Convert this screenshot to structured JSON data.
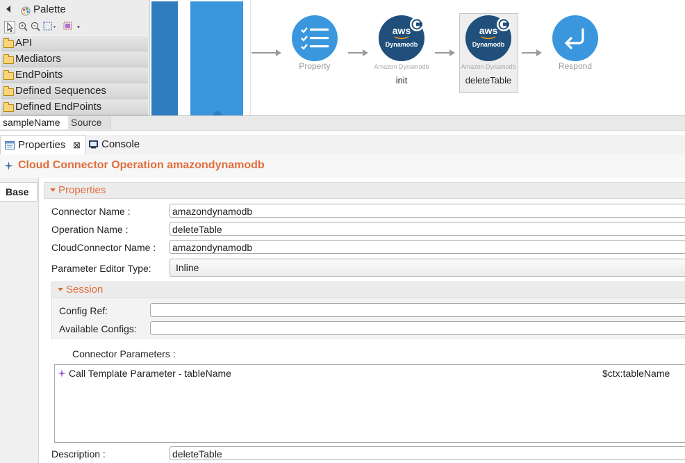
{
  "palette": {
    "title": "Palette",
    "categories": [
      "API",
      "Mediators",
      "EndPoints",
      "Defined Sequences",
      "Defined EndPoints"
    ]
  },
  "canvas": {
    "nodes": [
      {
        "label": "Property",
        "sub": "",
        "name": ""
      },
      {
        "label": "",
        "sub": "Amazon Dynamodb",
        "name": "init",
        "aws": "aws",
        "aws_sub": "Dynamodb"
      },
      {
        "label": "",
        "sub": "Amazon Dynamodb",
        "name": "deleteTable",
        "aws": "aws",
        "aws_sub": "Dynamodb"
      },
      {
        "label": "Respond",
        "sub": "",
        "name": ""
      }
    ]
  },
  "editor_tabs": [
    "sampleName",
    "Source"
  ],
  "view_tabs": {
    "properties": "Properties",
    "console": "Console"
  },
  "section_title": "Cloud Connector Operation amazondynamodb",
  "base_tab": "Base",
  "properties_group": {
    "title": "Properties",
    "connector_name_label": "Connector Name :",
    "connector_name": "amazondynamodb",
    "operation_name_label": "Operation Name :",
    "operation_name": "deleteTable",
    "cloud_connector_name_label": "CloudConnector Name :",
    "cloud_connector_name": "amazondynamodb",
    "param_editor_type_label": "Parameter Editor Type:",
    "param_editor_type": "Inline"
  },
  "session_group": {
    "title": "Session",
    "config_ref_label": "Config Ref:",
    "config_ref": "",
    "available_configs_label": "Available Configs:",
    "available_configs": ""
  },
  "connector_parameters": {
    "label": "Connector Parameters :",
    "rows": [
      {
        "name": "Call Template Parameter  -  tableName",
        "value": "$ctx:tableName"
      }
    ]
  },
  "description": {
    "label": "Description :",
    "value": "deleteTable"
  },
  "colors": {
    "accent": "#e06d3a",
    "node_blue": "#3a97de",
    "node_dark": "#1f4f7a"
  }
}
